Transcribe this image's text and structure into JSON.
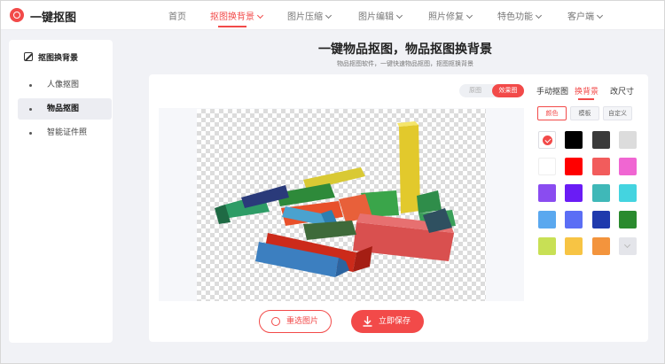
{
  "app": {
    "brand": "一键抠图"
  },
  "nav": [
    {
      "label": "首页",
      "active": false,
      "dropdown": false
    },
    {
      "label": "抠图换背景",
      "active": true,
      "dropdown": true
    },
    {
      "label": "图片压缩",
      "active": false,
      "dropdown": true
    },
    {
      "label": "图片编辑",
      "active": false,
      "dropdown": true
    },
    {
      "label": "照片修复",
      "active": false,
      "dropdown": true
    },
    {
      "label": "特色功能",
      "active": false,
      "dropdown": true
    },
    {
      "label": "客户端",
      "active": false,
      "dropdown": true
    }
  ],
  "sidebar": {
    "title": "抠图换背景",
    "icon": "crop-icon",
    "items": [
      {
        "label": "人像抠图",
        "active": false
      },
      {
        "label": "物品抠图",
        "active": true
      },
      {
        "label": "智能证件照",
        "active": false
      }
    ]
  },
  "header": {
    "title": "一键物品抠图，物品抠图换背景",
    "subtitle": "物品抠图软件，一键快速物品抠图，抠图抠换背景"
  },
  "view_toggle": {
    "original": "原图",
    "result": "效果图",
    "selected": "效果图"
  },
  "right_panel": {
    "tabs": [
      {
        "label": "手动抠图",
        "active": false
      },
      {
        "label": "换背景",
        "active": true
      },
      {
        "label": "改尺寸",
        "active": false
      }
    ],
    "subtabs": [
      {
        "label": "颜色",
        "active": true
      },
      {
        "label": "模板",
        "active": false
      },
      {
        "label": "自定义",
        "active": false
      }
    ],
    "swatches": [
      {
        "color": "transparent",
        "selected": true
      },
      {
        "color": "#000000"
      },
      {
        "color": "#3a3a3a"
      },
      {
        "color": "#dcdcdc"
      },
      {
        "color": "#ffffff"
      },
      {
        "color": "#ff0000"
      },
      {
        "color": "#f25c5c"
      },
      {
        "color": "#f066d2"
      },
      {
        "color": "#8a4cf0"
      },
      {
        "color": "#6a1cf5"
      },
      {
        "color": "#3fb8b8"
      },
      {
        "color": "#44d4e0"
      },
      {
        "color": "#5aa8ef"
      },
      {
        "color": "#5b6ef5"
      },
      {
        "color": "#1f3aad"
      },
      {
        "color": "#2a8a2e"
      },
      {
        "color": "#c8e055"
      },
      {
        "color": "#f7c444"
      },
      {
        "color": "#f3943d"
      },
      {
        "color": "more",
        "icon": "chevron-down-icon"
      }
    ]
  },
  "actions": {
    "reselect": "重选图片",
    "save": "立即保存"
  },
  "colors": {
    "accent": "#f24a49",
    "page_bg": "#f1f2f6"
  }
}
